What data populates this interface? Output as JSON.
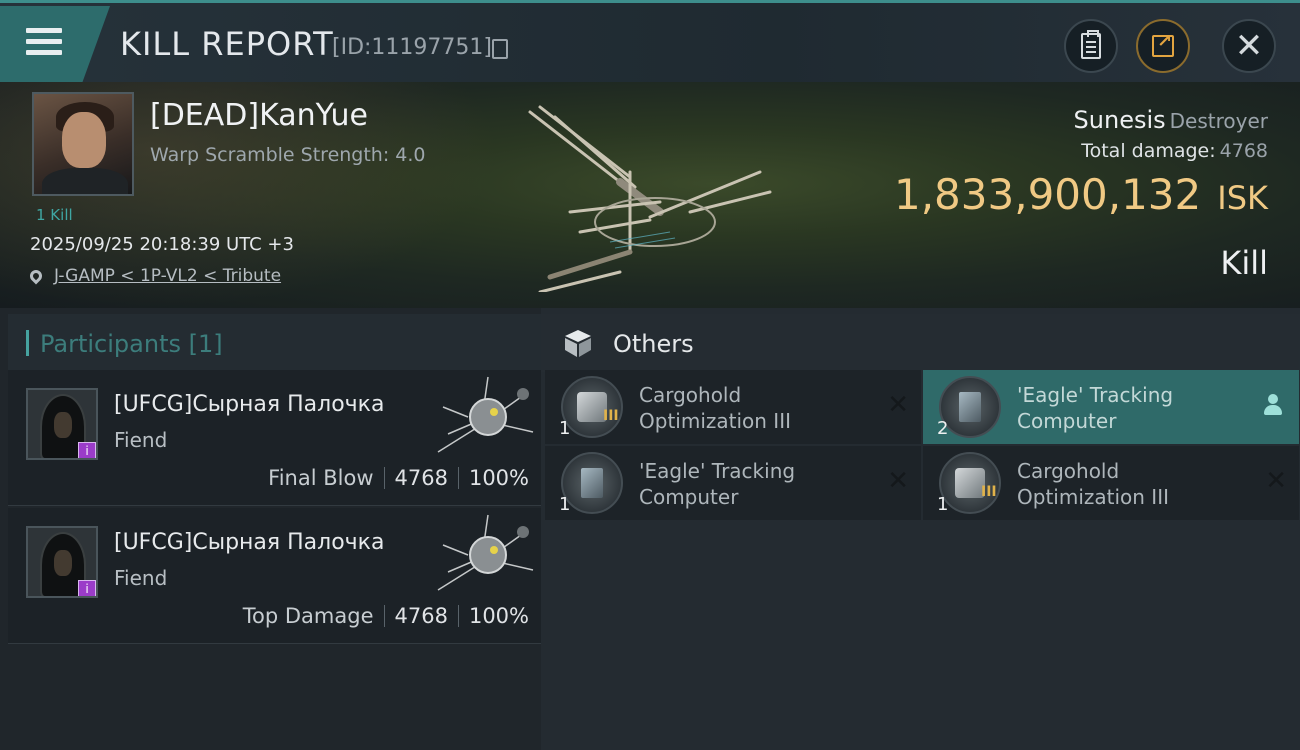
{
  "header": {
    "title": "KILL REPORT",
    "report_id": "[ID:11197751]",
    "buttons": [
      "clipboard-icon",
      "share-icon",
      "close-icon"
    ],
    "close_glyph": "✕"
  },
  "victim": {
    "name": "[DEAD]KanYue",
    "warp_scramble": "Warp Scramble Strength: 4.0",
    "kill_count": "1 Kill",
    "timestamp": "2025/09/25 20:18:39 UTC +3",
    "location": "J-GAMP < 1P-VL2 < Tribute",
    "ship_name": "Sunesis",
    "ship_class": "Destroyer",
    "total_damage_label": "Total damage:",
    "total_damage": "4768",
    "isk_value": "1,833,900,132",
    "isk_unit": "ISK",
    "result": "Kill"
  },
  "participants": {
    "title": "Participants [1]",
    "items": [
      {
        "name": "[UFCG]Сырная Палочка",
        "ship": "Fiend",
        "badge": "i",
        "role": "Final Blow",
        "damage": "4768",
        "percent": "100%"
      },
      {
        "name": "[UFCG]Сырная Палочка",
        "ship": "Fiend",
        "badge": "i",
        "role": "Top Damage",
        "damage": "4768",
        "percent": "100%"
      }
    ]
  },
  "others": {
    "title": "Others",
    "items": [
      {
        "qty": "1",
        "name": "Cargohold Optimization III",
        "icon": "cargohold-icon",
        "meta": "III",
        "status": "✕",
        "selected": false
      },
      {
        "qty": "2",
        "name": "'Eagle' Tracking Computer",
        "icon": "tracking-computer-icon",
        "meta": "",
        "status": "",
        "selected": true
      },
      {
        "qty": "1",
        "name": "'Eagle' Tracking Computer",
        "icon": "tracking-computer-icon",
        "meta": "",
        "status": "✕",
        "selected": false
      },
      {
        "qty": "1",
        "name": "Cargohold Optimization III",
        "icon": "cargohold-icon",
        "meta": "III",
        "status": "✕",
        "selected": false
      }
    ]
  },
  "colors": {
    "accent": "#3d8e8c",
    "isk": "#f0c984",
    "selected": "#2f6a69"
  }
}
